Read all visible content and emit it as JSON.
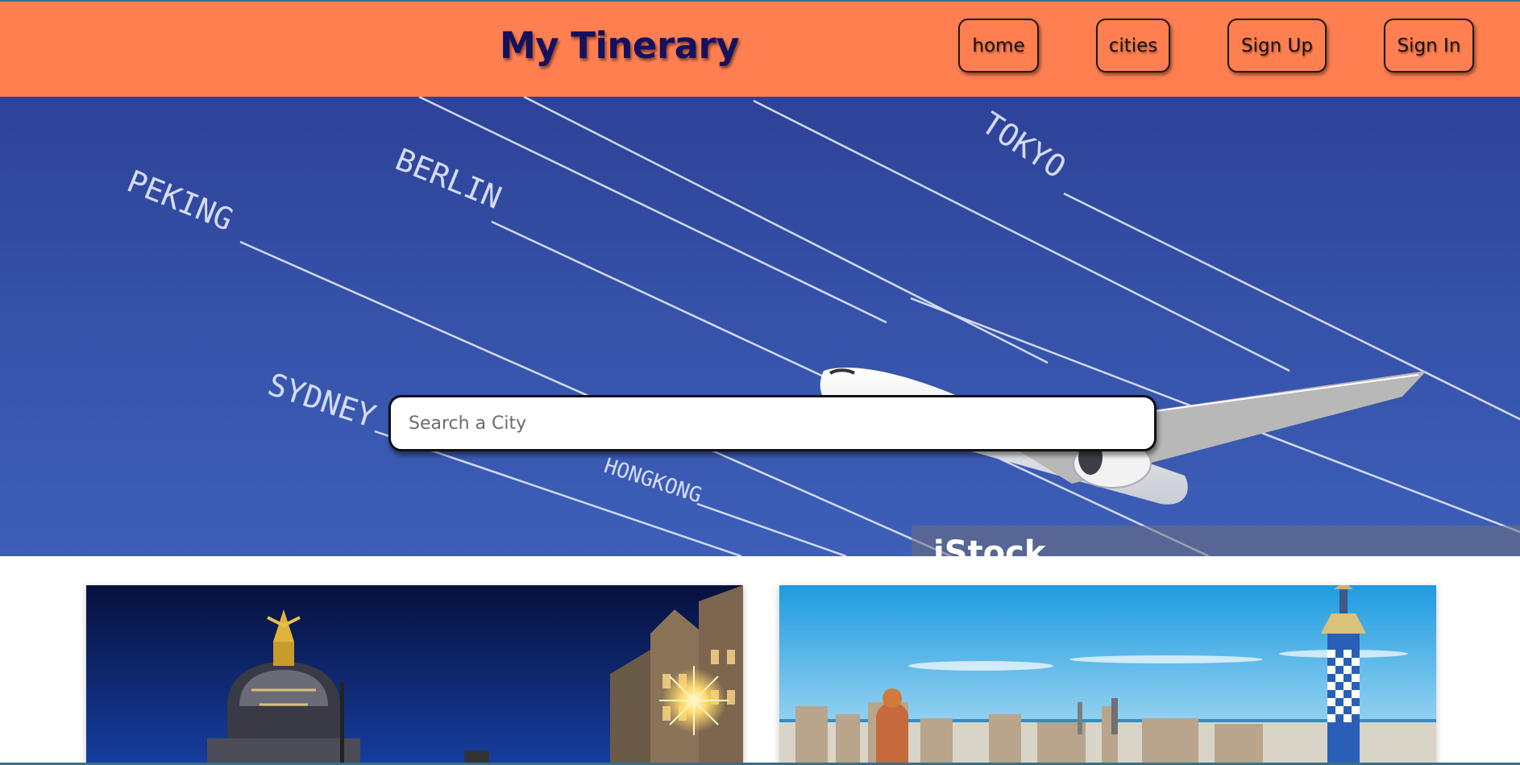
{
  "header": {
    "brand": "My Tinerary",
    "nav": {
      "home": "home",
      "cities": "cities",
      "sign_up": "Sign Up",
      "sign_in": "Sign In"
    }
  },
  "hero": {
    "search_placeholder": "Search a City",
    "city_labels": [
      "PEKING",
      "BERLIN",
      "TOKYO",
      "SYDNEY",
      "HONGKONG"
    ],
    "watermark": "iStock"
  },
  "cards": [
    {
      "image": "madrid-metropolis-night-photo"
    },
    {
      "image": "barcelona-park-guell-skyline-photo"
    }
  ],
  "colors": {
    "header_bg": "#ff7f50",
    "brand_text": "#15115e",
    "hero_sky": "#3551a8"
  }
}
